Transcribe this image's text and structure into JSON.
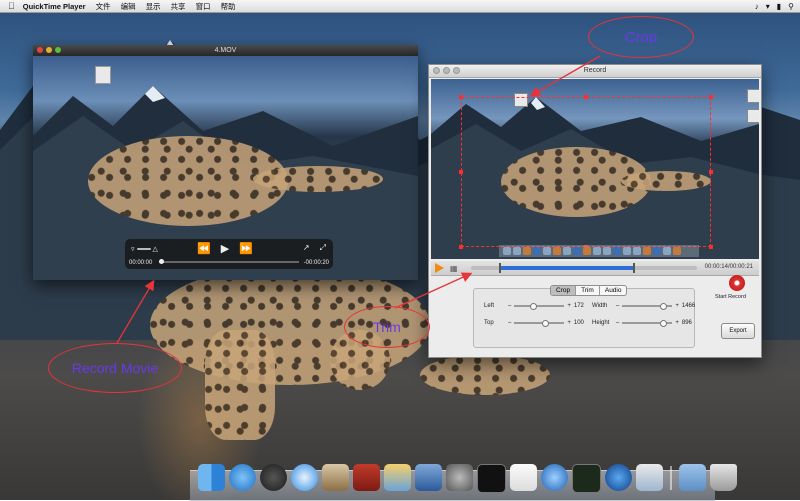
{
  "menubar": {
    "app_name": "QuickTime Player",
    "items": [
      "文件",
      "编辑",
      "显示",
      "共享",
      "窗口",
      "帮助"
    ],
    "apple_icon": "apple-icon",
    "status_icons": [
      "volume-icon",
      "wifi-icon",
      "battery-icon",
      "spotlight-icon"
    ]
  },
  "quicktime_window": {
    "title": "4.MOV",
    "current_time": "00:00:00",
    "remaining_time": "-00:00:20",
    "play_progress": 0
  },
  "record_window": {
    "title": "Record",
    "time_display": "00:00:14/00:00:21",
    "trim_selection": {
      "start_fraction": 0.13,
      "end_fraction": 0.72
    },
    "tabs": [
      "Crop",
      "Trim",
      "Audio"
    ],
    "active_tab": "Crop",
    "left_label": "Left",
    "left_value": "172",
    "top_label": "Top",
    "top_value": "100",
    "width_label": "Width",
    "width_value": "1466",
    "height_label": "Height",
    "height_value": "896",
    "start_record_label": "Start Record",
    "export_label": "Export"
  },
  "annotations": {
    "crop": "Crop",
    "trim": "Trim",
    "record_movie": "Record Movie",
    "color_ellipse": "#e6343a",
    "color_text": "#6b38e8"
  },
  "dock": {
    "icons": [
      "finder-icon",
      "app-store-icon",
      "dashboard-icon",
      "safari-icon",
      "mail-icon",
      "photo-booth-icon",
      "iphoto-icon",
      "xcode-icon",
      "system-preferences-icon",
      "terminal-icon",
      "textedit-icon",
      "itunes-icon",
      "activity-monitor-icon",
      "quicktime-icon",
      "preview-icon",
      "downloads-folder-icon",
      "trash-icon"
    ]
  }
}
